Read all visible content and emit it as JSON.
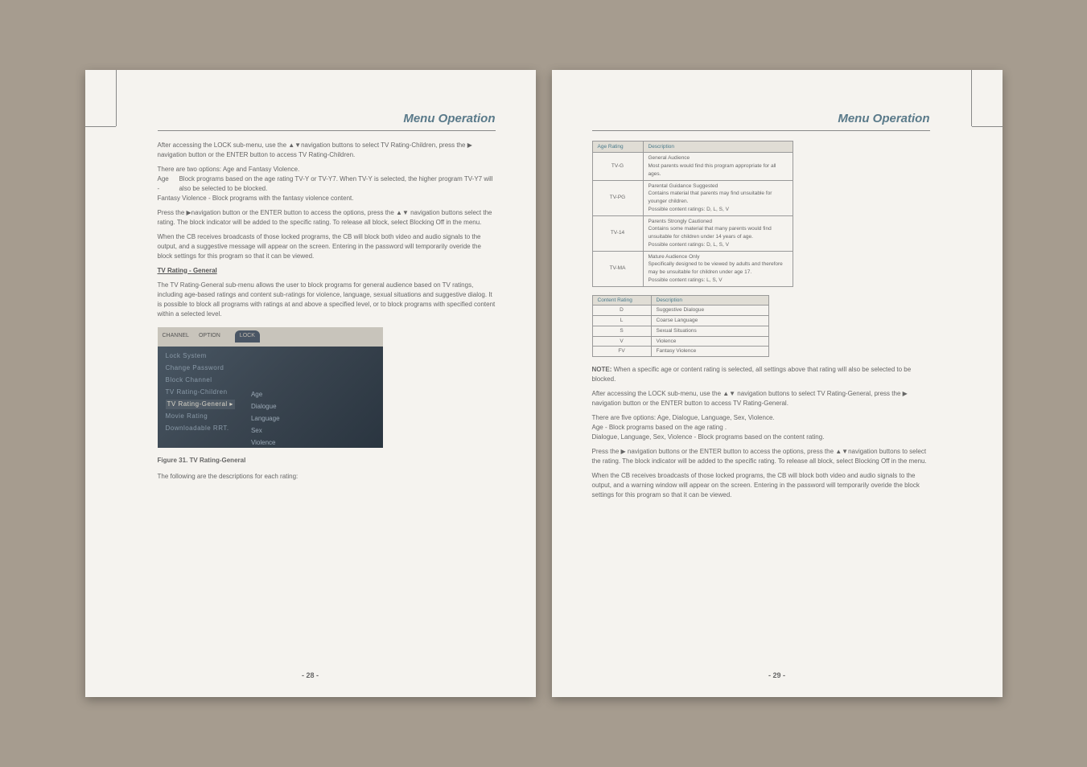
{
  "left": {
    "title": "Menu Operation",
    "p1": "After accessing the LOCK sub-menu, use the ▲▼navigation buttons to select TV Rating-Children, press the ▶ navigation button or the ENTER button to access TV Rating-Children.",
    "p2": "There are two options: Age and Fantasy Violence.",
    "p3a": "Age -",
    "p3b": "Block programs based on the age rating TV-Y or TV-Y7. When TV-Y is selected, the higher program TV-Y7 will also be selected to be blocked.",
    "p4": "Fantasy Violence - Block programs with the fantasy violence content.",
    "p5": "Press the ▶navigation button or the ENTER button to access the options, press the ▲▼ navigation buttons select the rating. The block indicator will be added to the specific rating. To release all block, select Blocking Off in the menu.",
    "p6": "When the CB receives broadcasts of those locked programs, the CB will block both video and audio signals to the output, and a suggestive message will appear on the screen. Entering in the password will temporarily overide the block settings for this program so that it can be viewed.",
    "h1": "TV Rating - General",
    "p7": "The TV Rating-General sub-menu allows the user to block programs for general audience based on TV ratings, including age-based ratings and content sub-ratings for violence, language, sexual situations and suggestive dialog. It is possible to block all programs with ratings at and above a specified level, or to block programs with specified content within a selected level.",
    "figcap": "Figure 31. TV Rating-General",
    "p8": "The following are the descriptions for each rating:",
    "pagenum": "- 28 -",
    "figure": {
      "tabs": [
        "CHANNEL",
        "OPTION",
        "",
        "LOCK"
      ],
      "menu": [
        "Lock System",
        "Change Password",
        "Block Channel",
        "TV Rating-Children",
        "TV Rating-General ▸",
        "Movie Rating",
        "Downloadable RRT."
      ],
      "sub": [
        "Age",
        "Dialogue",
        "Language",
        "Sex",
        "Violence"
      ]
    }
  },
  "right": {
    "title": "Menu Operation",
    "age_table": {
      "headers": [
        "Age Rating",
        "Description"
      ],
      "rows": [
        {
          "rating": "TV-G",
          "desc": "General Audience\nMost parents would find this program appropriate for all ages."
        },
        {
          "rating": "TV-PG",
          "desc": "Parental Guidance Suggested\nContains material that parents may find unsuitable for younger children.\nPossible content ratings: D, L, S, V"
        },
        {
          "rating": "TV-14",
          "desc": "Parents Strongly Cautioned\nContains some material that many parents would find unsuitable for children under 14 years of age.\nPossible content ratings: D, L, S, V"
        },
        {
          "rating": "TV-MA",
          "desc": "Mature Audience Only\nSpecifically designed to be viewed by adults and therefore may be unsuitable for children under age 17.\nPossible content ratings: L, S, V"
        }
      ]
    },
    "content_table": {
      "headers": [
        "Content Rating",
        "Description"
      ],
      "rows": [
        {
          "r": "D",
          "d": "Suggestive Dialogue"
        },
        {
          "r": "L",
          "d": "Coarse Language"
        },
        {
          "r": "S",
          "d": "Sexual Situations"
        },
        {
          "r": "V",
          "d": "Violence"
        },
        {
          "r": "FV",
          "d": "Fantasy Violence"
        }
      ]
    },
    "note_label": "NOTE:",
    "note": "When a specific age or content rating is selected, all settings above that rating will also be selected to be blocked.",
    "p1": "After accessing the LOCK sub-menu, use the ▲▼ navigation buttons to select TV Rating-General, press the ▶ navigation button or the ENTER button to access TV Rating-General.",
    "p2": "There are five options: Age, Dialogue, Language, Sex, Violence.",
    "p3": "Age - Block programs based on the age rating .",
    "p4": "Dialogue, Language, Sex, Violence - Block programs based on the content rating.",
    "p5": "Press the ▶ navigation buttons or the ENTER button to access the options, press the ▲▼navigation buttons to select the rating. The block indicator will be added to the specific rating. To release all block, select Blocking Off in the menu.",
    "p6": "When the CB receives broadcasts of those locked programs, the CB will block both video and audio signals to the output, and a warning window will appear on the screen. Entering in the password will temporarily overide the block settings for this program so that it can be viewed.",
    "pagenum": "- 29 -"
  }
}
